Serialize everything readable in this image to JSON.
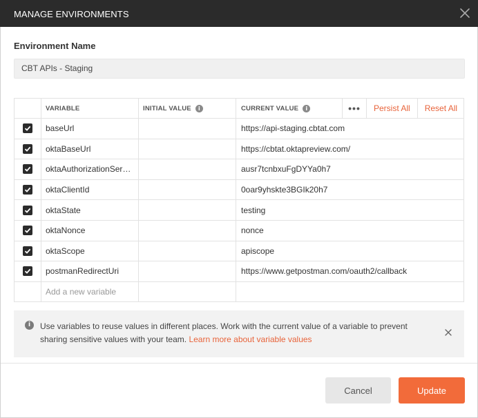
{
  "dialog": {
    "title": "MANAGE ENVIRONMENTS"
  },
  "environment": {
    "label": "Environment Name",
    "name": "CBT APIs - Staging"
  },
  "table": {
    "headers": {
      "variable": "VARIABLE",
      "initial_value": "INITIAL VALUE",
      "current_value": "CURRENT VALUE",
      "more": "•••",
      "persist_all": "Persist All",
      "reset_all": "Reset All"
    },
    "rows": [
      {
        "checked": true,
        "variable": "baseUrl",
        "initial": "",
        "current": "https://api-staging.cbtat.com"
      },
      {
        "checked": true,
        "variable": "oktaBaseUrl",
        "initial": "",
        "current": "https://cbtat.oktapreview.com/"
      },
      {
        "checked": true,
        "variable": "oktaAuthorizationSer…",
        "initial": "",
        "current": "ausr7tcnbxuFgDYYa0h7"
      },
      {
        "checked": true,
        "variable": "oktaClientId",
        "initial": "",
        "current": "0oar9yhskte3BGIk20h7"
      },
      {
        "checked": true,
        "variable": "oktaState",
        "initial": "",
        "current": "testing"
      },
      {
        "checked": true,
        "variable": "oktaNonce",
        "initial": "",
        "current": "nonce"
      },
      {
        "checked": true,
        "variable": "oktaScope",
        "initial": "",
        "current": "apiscope"
      },
      {
        "checked": true,
        "variable": "postmanRedirectUri",
        "initial": "",
        "current": "https://www.getpostman.com/oauth2/callback"
      }
    ],
    "add_placeholder": "Add a new variable"
  },
  "info": {
    "text": "Use variables to reuse values in different places. Work with the current value of a variable to prevent sharing sensitive values with your team.",
    "link": "Learn more about variable values"
  },
  "buttons": {
    "cancel": "Cancel",
    "update": "Update"
  },
  "colors": {
    "accent": "#f26b3a",
    "link": "#e8633a",
    "titlebar": "#2b2b2b"
  }
}
